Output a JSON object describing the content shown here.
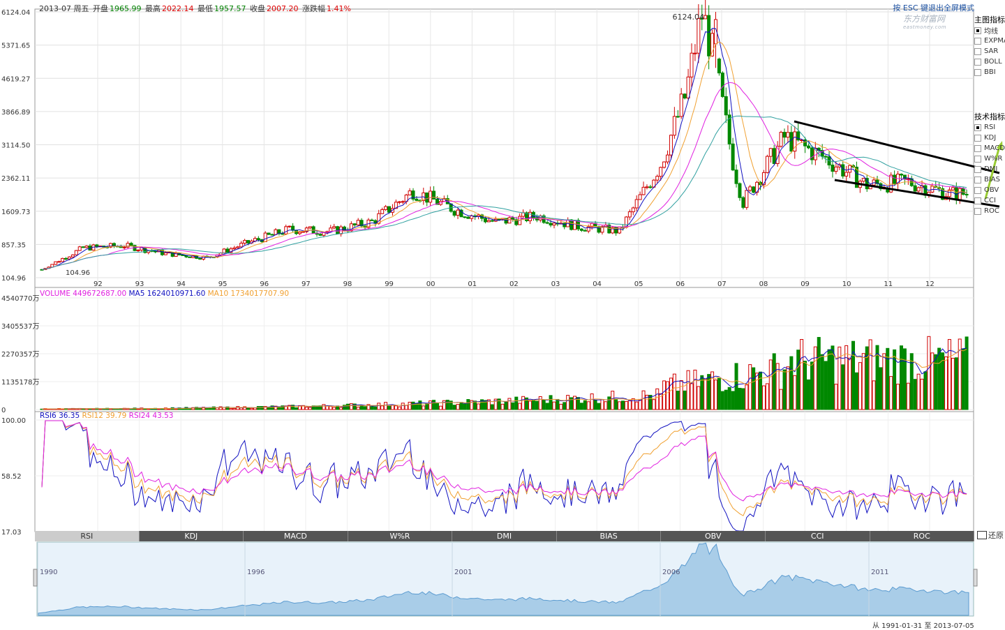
{
  "header": {
    "date": "2013-07 周五",
    "open_label": "开盘",
    "open": "1965.99",
    "high_label": "最高",
    "high": "2022.14",
    "low_label": "最低",
    "low": "1957.57",
    "close_label": "收盘",
    "close": "2007.20",
    "chg_label": "涨跌幅",
    "chg": "1.41%"
  },
  "esc_hint": "按 ESC 键退出全屏模式",
  "logo": {
    "name": "东方财富网",
    "sub": "eastmoney.com"
  },
  "main_indicators": {
    "title": "主图指标",
    "items": [
      {
        "label": "均线",
        "checked": true
      },
      {
        "label": "EXPMA",
        "checked": false
      },
      {
        "label": "SAR",
        "checked": false
      },
      {
        "label": "BOLL",
        "checked": false
      },
      {
        "label": "BBI",
        "checked": false
      }
    ]
  },
  "tech_indicators": {
    "title": "技术指标",
    "items": [
      {
        "label": "RSI",
        "checked": true
      },
      {
        "label": "KDJ",
        "checked": false
      },
      {
        "label": "MACD",
        "checked": false
      },
      {
        "label": "W%R",
        "checked": false
      },
      {
        "label": "DMI",
        "checked": false
      },
      {
        "label": "BIAS",
        "checked": false
      },
      {
        "label": "OBV",
        "checked": false
      },
      {
        "label": "CCI",
        "checked": false
      },
      {
        "label": "ROC",
        "checked": false
      }
    ]
  },
  "volume_legend": {
    "vol": "VOLUME 449672687.00",
    "ma5": "MA5 1624010971.60",
    "ma10": "MA10 1734017707.90"
  },
  "rsi_legend": {
    "rsi6": "RSI6 36.35",
    "rsi12": "RSI12 39.79",
    "rsi24": "RSI24 43.53"
  },
  "tabs": [
    "RSI",
    "KDJ",
    "MACD",
    "W%R",
    "DMI",
    "BIAS",
    "OBV",
    "CCI",
    "ROC"
  ],
  "active_tab": "RSI",
  "restore_label": "还原",
  "footer": "从 1991-01-31 至 2013-07-05",
  "nav_years": [
    "1990",
    "1996",
    "2001",
    "2006",
    "2011"
  ],
  "chart_data": [
    {
      "type": "candlestick",
      "title": "",
      "y_ticks": [
        "6124.04",
        "5371.65",
        "4619.27",
        "3866.89",
        "3114.50",
        "2362.11",
        "1609.73",
        "857.35",
        "104.96"
      ],
      "ylim": [
        104.96,
        6124.04
      ],
      "x_ticks": [
        "92",
        "93",
        "94",
        "95",
        "96",
        "97",
        "98",
        "99",
        "00",
        "01",
        "02",
        "03",
        "04",
        "05",
        "06",
        "07",
        "08",
        "09",
        "10",
        "11",
        "12"
      ],
      "annotations": [
        "6124.04",
        "104.96"
      ],
      "series_close_by_year": [
        {
          "x": "91",
          "close": 290
        },
        {
          "x": "92",
          "close": 780
        },
        {
          "x": "93",
          "close": 830
        },
        {
          "x": "94",
          "close": 650
        },
        {
          "x": "95",
          "close": 560
        },
        {
          "x": "96",
          "close": 900
        },
        {
          "x": "97",
          "close": 1200
        },
        {
          "x": "98",
          "close": 1150
        },
        {
          "x": "99",
          "close": 1370
        },
        {
          "x": "00",
          "close": 2070
        },
        {
          "x": "01",
          "close": 1650
        },
        {
          "x": "02",
          "close": 1360
        },
        {
          "x": "03",
          "close": 1500
        },
        {
          "x": "04",
          "close": 1270
        },
        {
          "x": "05",
          "close": 1160
        },
        {
          "x": "06",
          "close": 2680
        },
        {
          "x": "07",
          "close": 5260
        },
        {
          "x": "08",
          "close": 1820
        },
        {
          "x": "09",
          "close": 3280
        },
        {
          "x": "10",
          "close": 2810
        },
        {
          "x": "11",
          "close": 2200
        },
        {
          "x": "12",
          "close": 2270
        },
        {
          "x": "13",
          "close": 2007
        }
      ],
      "colors": {
        "up": "#d00000",
        "down": "#008800",
        "ma_blue": "#1010c0",
        "ma_orange": "#f0a030",
        "ma_magenta": "#e020e0",
        "ma_teal": "#30a0a0"
      }
    },
    {
      "type": "bar",
      "title": "VOLUME",
      "y_ticks": [
        "4540770万",
        "3405537万",
        "2270357万",
        "1135178万",
        "0"
      ],
      "ylim": [
        0,
        4540770
      ]
    },
    {
      "type": "line",
      "title": "RSI",
      "y_ticks": [
        "100.00",
        "58.52",
        "17.03"
      ],
      "ylim": [
        17.03,
        100
      ],
      "series": [
        {
          "name": "RSI6"
        },
        {
          "name": "RSI12"
        },
        {
          "name": "RSI24"
        }
      ]
    }
  ]
}
